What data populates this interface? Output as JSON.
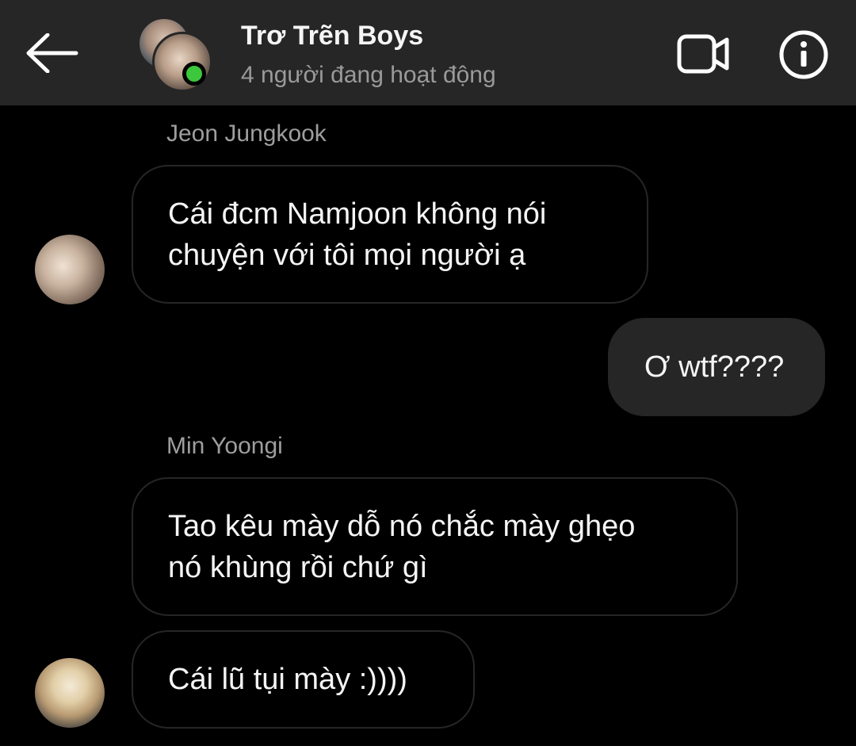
{
  "header": {
    "title": "Trơ Trẽn Boys",
    "status": "4 người đang hoạt động",
    "icons": {
      "back": "arrow-left-icon",
      "video": "video-camera-icon",
      "info": "info-icon"
    },
    "background": "#262626",
    "online_color": "#3cc73c"
  },
  "messages": [
    {
      "sender": "Jeon Jungkook",
      "direction": "incoming",
      "lines": [
        "Cái đcm Namjoon không nói",
        "chuyện với tôi mọi người ạ"
      ]
    },
    {
      "sender": "",
      "direction": "outgoing",
      "lines": [
        "Ơ wtf????"
      ]
    },
    {
      "sender": "Min Yoongi",
      "direction": "incoming",
      "lines": [
        "Tao kêu mày dỗ nó chắc mày ghẹo",
        "nó khùng rồi chứ gì"
      ]
    },
    {
      "sender": "",
      "direction": "incoming",
      "lines": [
        "Cái lũ tụi mày :))))"
      ]
    }
  ]
}
